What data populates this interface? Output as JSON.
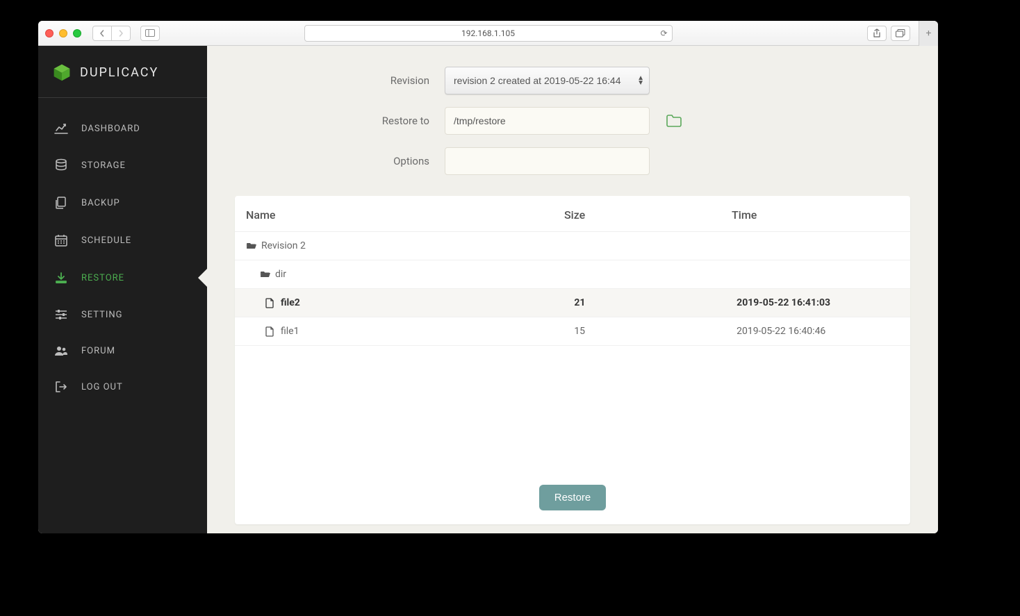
{
  "browser": {
    "url": "192.168.1.105"
  },
  "brand": "DUPLICACY",
  "nav": {
    "dashboard": "DASHBOARD",
    "storage": "STORAGE",
    "backup": "BACKUP",
    "schedule": "SCHEDULE",
    "restore": "RESTORE",
    "setting": "SETTING",
    "forum": "FORUM",
    "logout": "LOG OUT"
  },
  "form": {
    "revision_label": "Revision",
    "revision_value": "revision 2 created at 2019-05-22 16:44",
    "restore_to_label": "Restore to",
    "restore_to_value": "/tmp/restore",
    "options_label": "Options",
    "options_value": ""
  },
  "table": {
    "headers": {
      "name": "Name",
      "size": "Size",
      "time": "Time"
    },
    "rows": [
      {
        "type": "folder",
        "indent": 0,
        "name": "Revision 2",
        "size": "",
        "time": "",
        "selected": false
      },
      {
        "type": "folder",
        "indent": 1,
        "name": "dir",
        "size": "",
        "time": "",
        "selected": false
      },
      {
        "type": "file",
        "indent": 2,
        "name": "file2",
        "size": "21",
        "time": "2019-05-22 16:41:03",
        "selected": true
      },
      {
        "type": "file",
        "indent": 2,
        "name": "file1",
        "size": "15",
        "time": "2019-05-22 16:40:46",
        "selected": false
      }
    ]
  },
  "buttons": {
    "restore": "Restore"
  }
}
